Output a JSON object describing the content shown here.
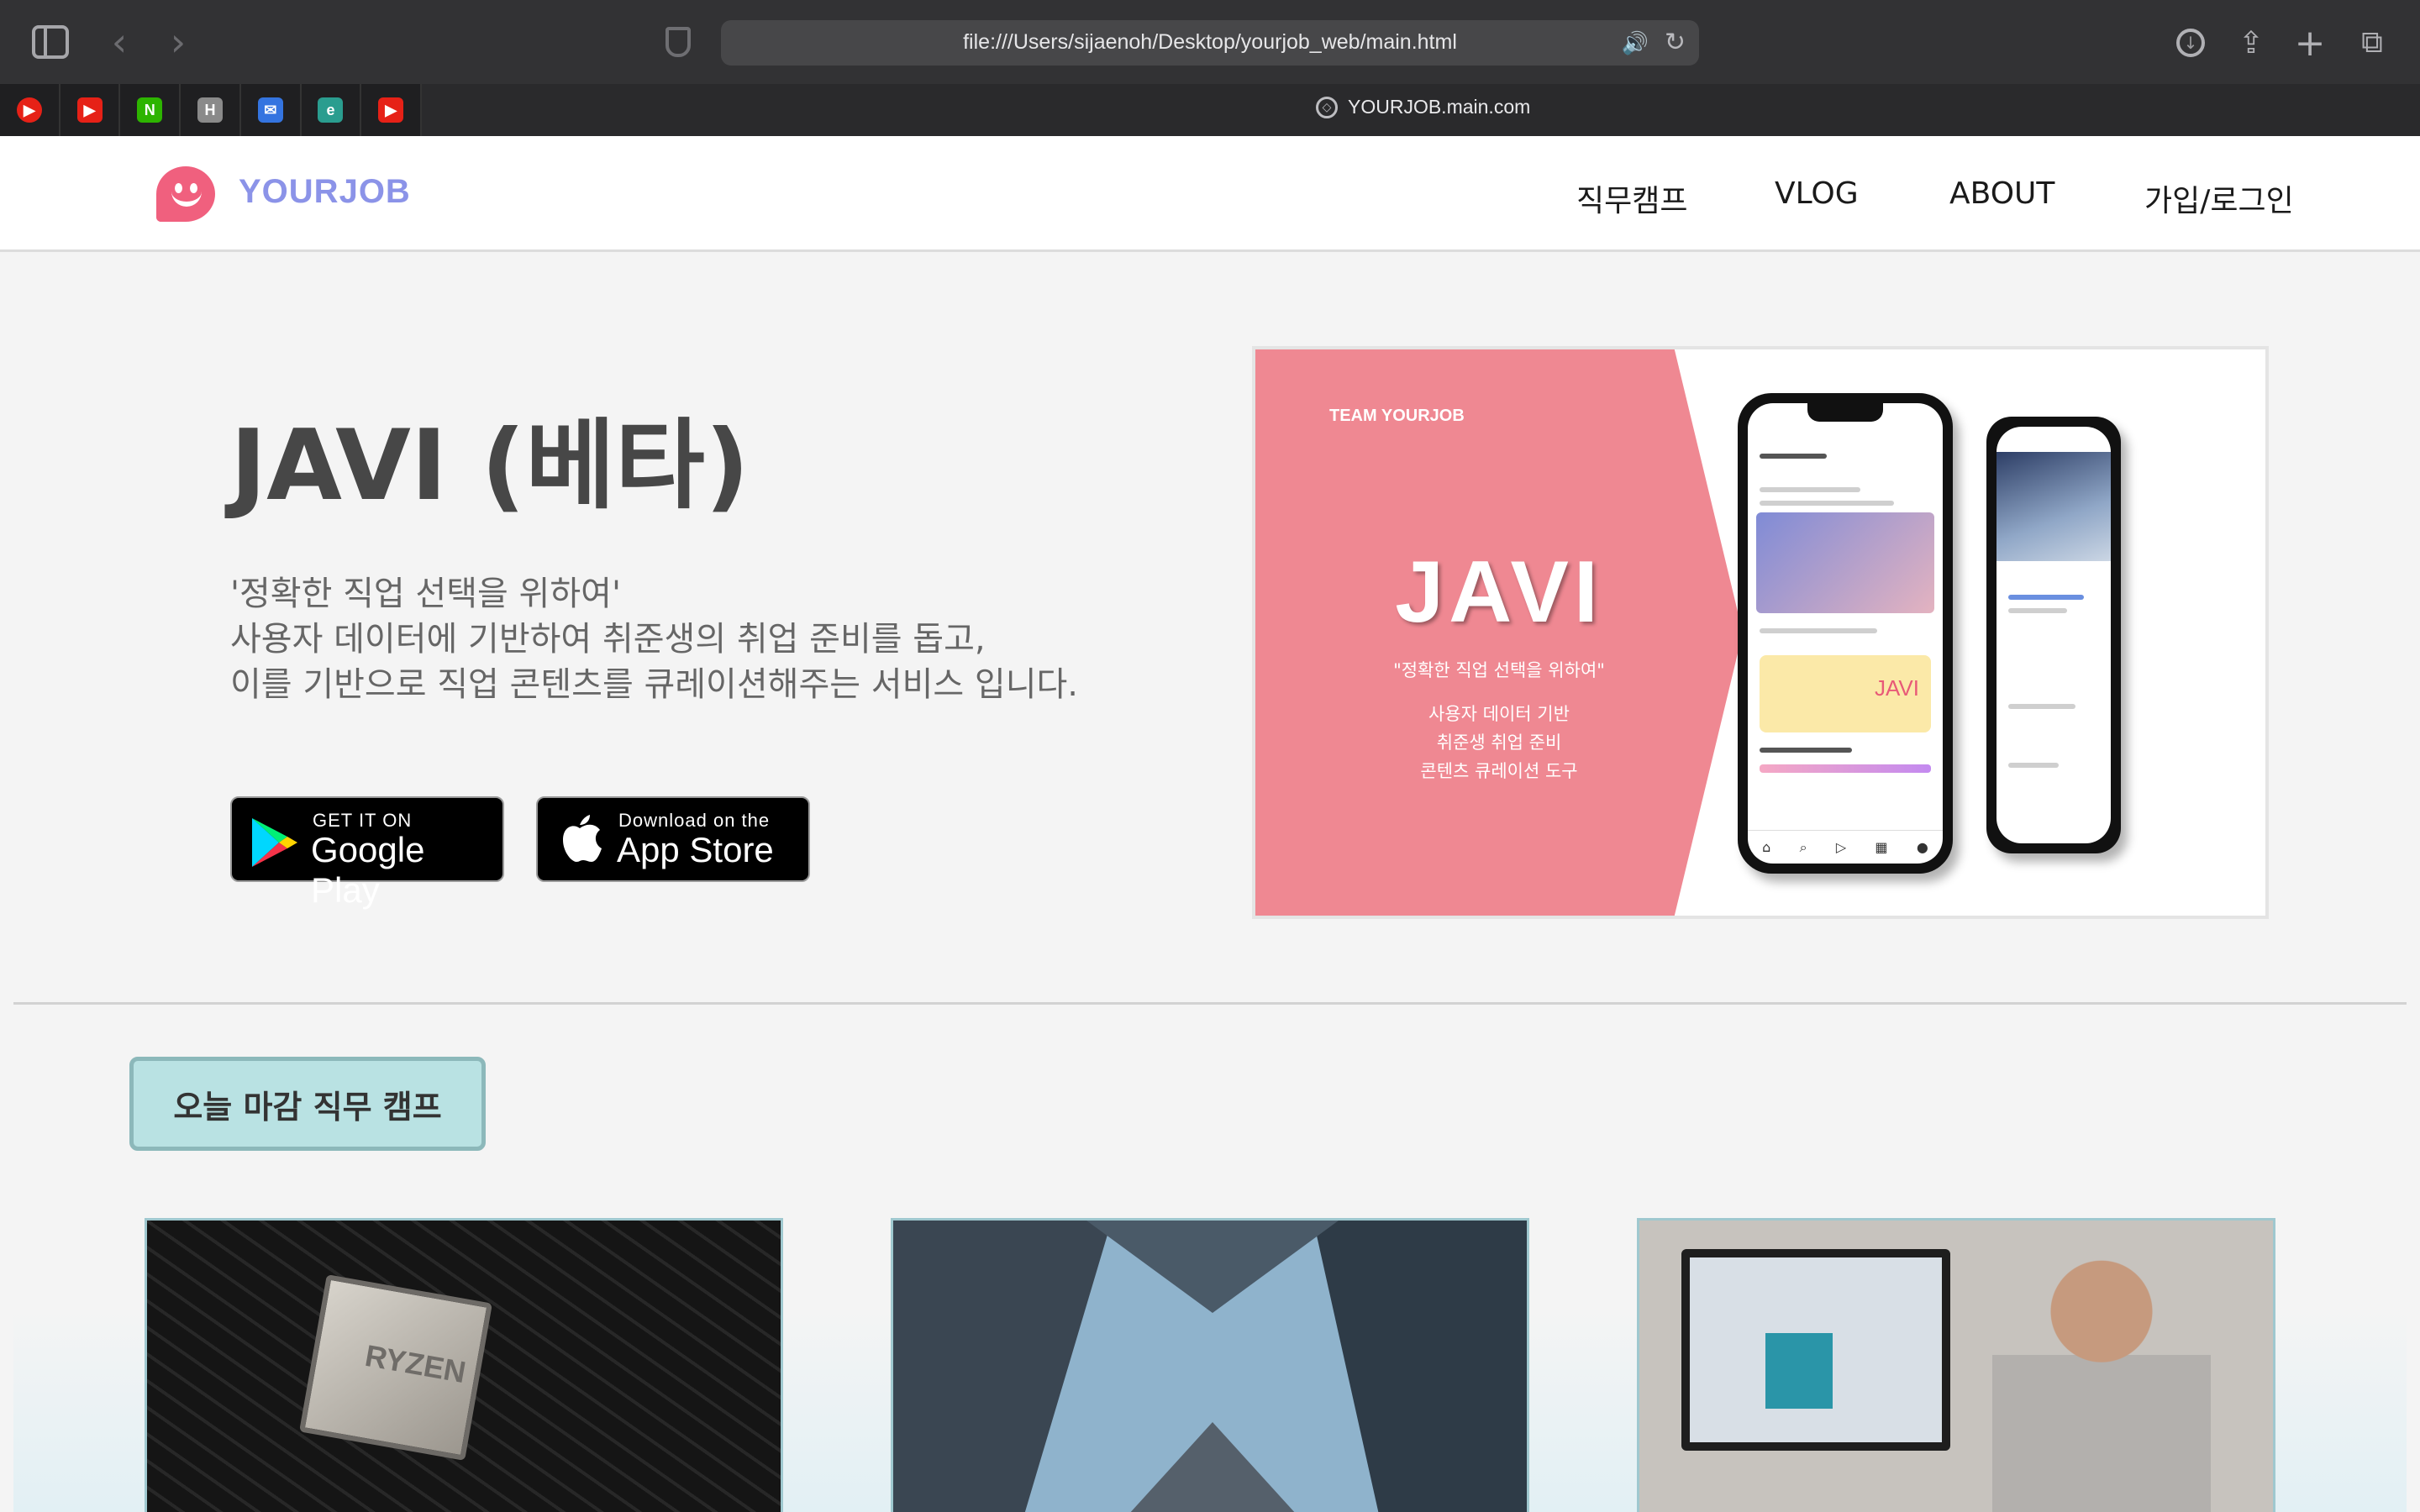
{
  "browser": {
    "url": "file:///Users/sijaenoh/Desktop/yourjob_web/main.html",
    "active_tab_title": "YOURJOB.main.com",
    "pinned_tabs": [
      {
        "icon": "youtube-music-icon",
        "color": "#e62117",
        "glyph": "▶"
      },
      {
        "icon": "youtube-icon",
        "color": "#e62117",
        "glyph": "▶"
      },
      {
        "icon": "naver-icon",
        "color": "#2db400",
        "glyph": "N"
      },
      {
        "icon": "h-icon",
        "color": "#8a8a8a",
        "glyph": "H"
      },
      {
        "icon": "mail-icon",
        "color": "#3474e0",
        "glyph": "✉"
      },
      {
        "icon": "edge-icon",
        "color": "#2a9d8f",
        "glyph": "e"
      },
      {
        "icon": "youtube-icon",
        "color": "#e62117",
        "glyph": "▶"
      }
    ]
  },
  "header": {
    "logo_text": "YOURJOB",
    "nav": [
      "직무캠프",
      "VLOG",
      "ABOUT",
      "가입/로그인"
    ]
  },
  "hero": {
    "title": "JAVI (베타)",
    "description": [
      "'정확한 직업 선택을 위하여'",
      "사용자 데이터에 기반하여 취준생의 취업 준비를 돕고,",
      "이를 기반으로 직업 콘텐츠를 큐레이션해주는 서비스 입니다."
    ],
    "google_play": {
      "small": "GET IT ON",
      "big": "Google Play"
    },
    "app_store": {
      "small": "Download on the",
      "big": "App Store"
    },
    "promo": {
      "team": "TEAM YOURJOB",
      "title": "JAVI",
      "tagline": "\"정확한 직업 선택을 위하여\"",
      "lines": [
        "사용자 데이터 기반",
        "취준생 취업 준비",
        "콘텐츠 큐레이션 도구"
      ],
      "phone_brand": "JAVI"
    }
  },
  "section": {
    "camp_button": "오늘 마감 직무 캠프",
    "chip_text": "RYZEN"
  },
  "colors": {
    "accent_pink": "#ef8892",
    "logo_purple": "#8b93e8",
    "camp_button_bg": "#b9e2e3"
  }
}
